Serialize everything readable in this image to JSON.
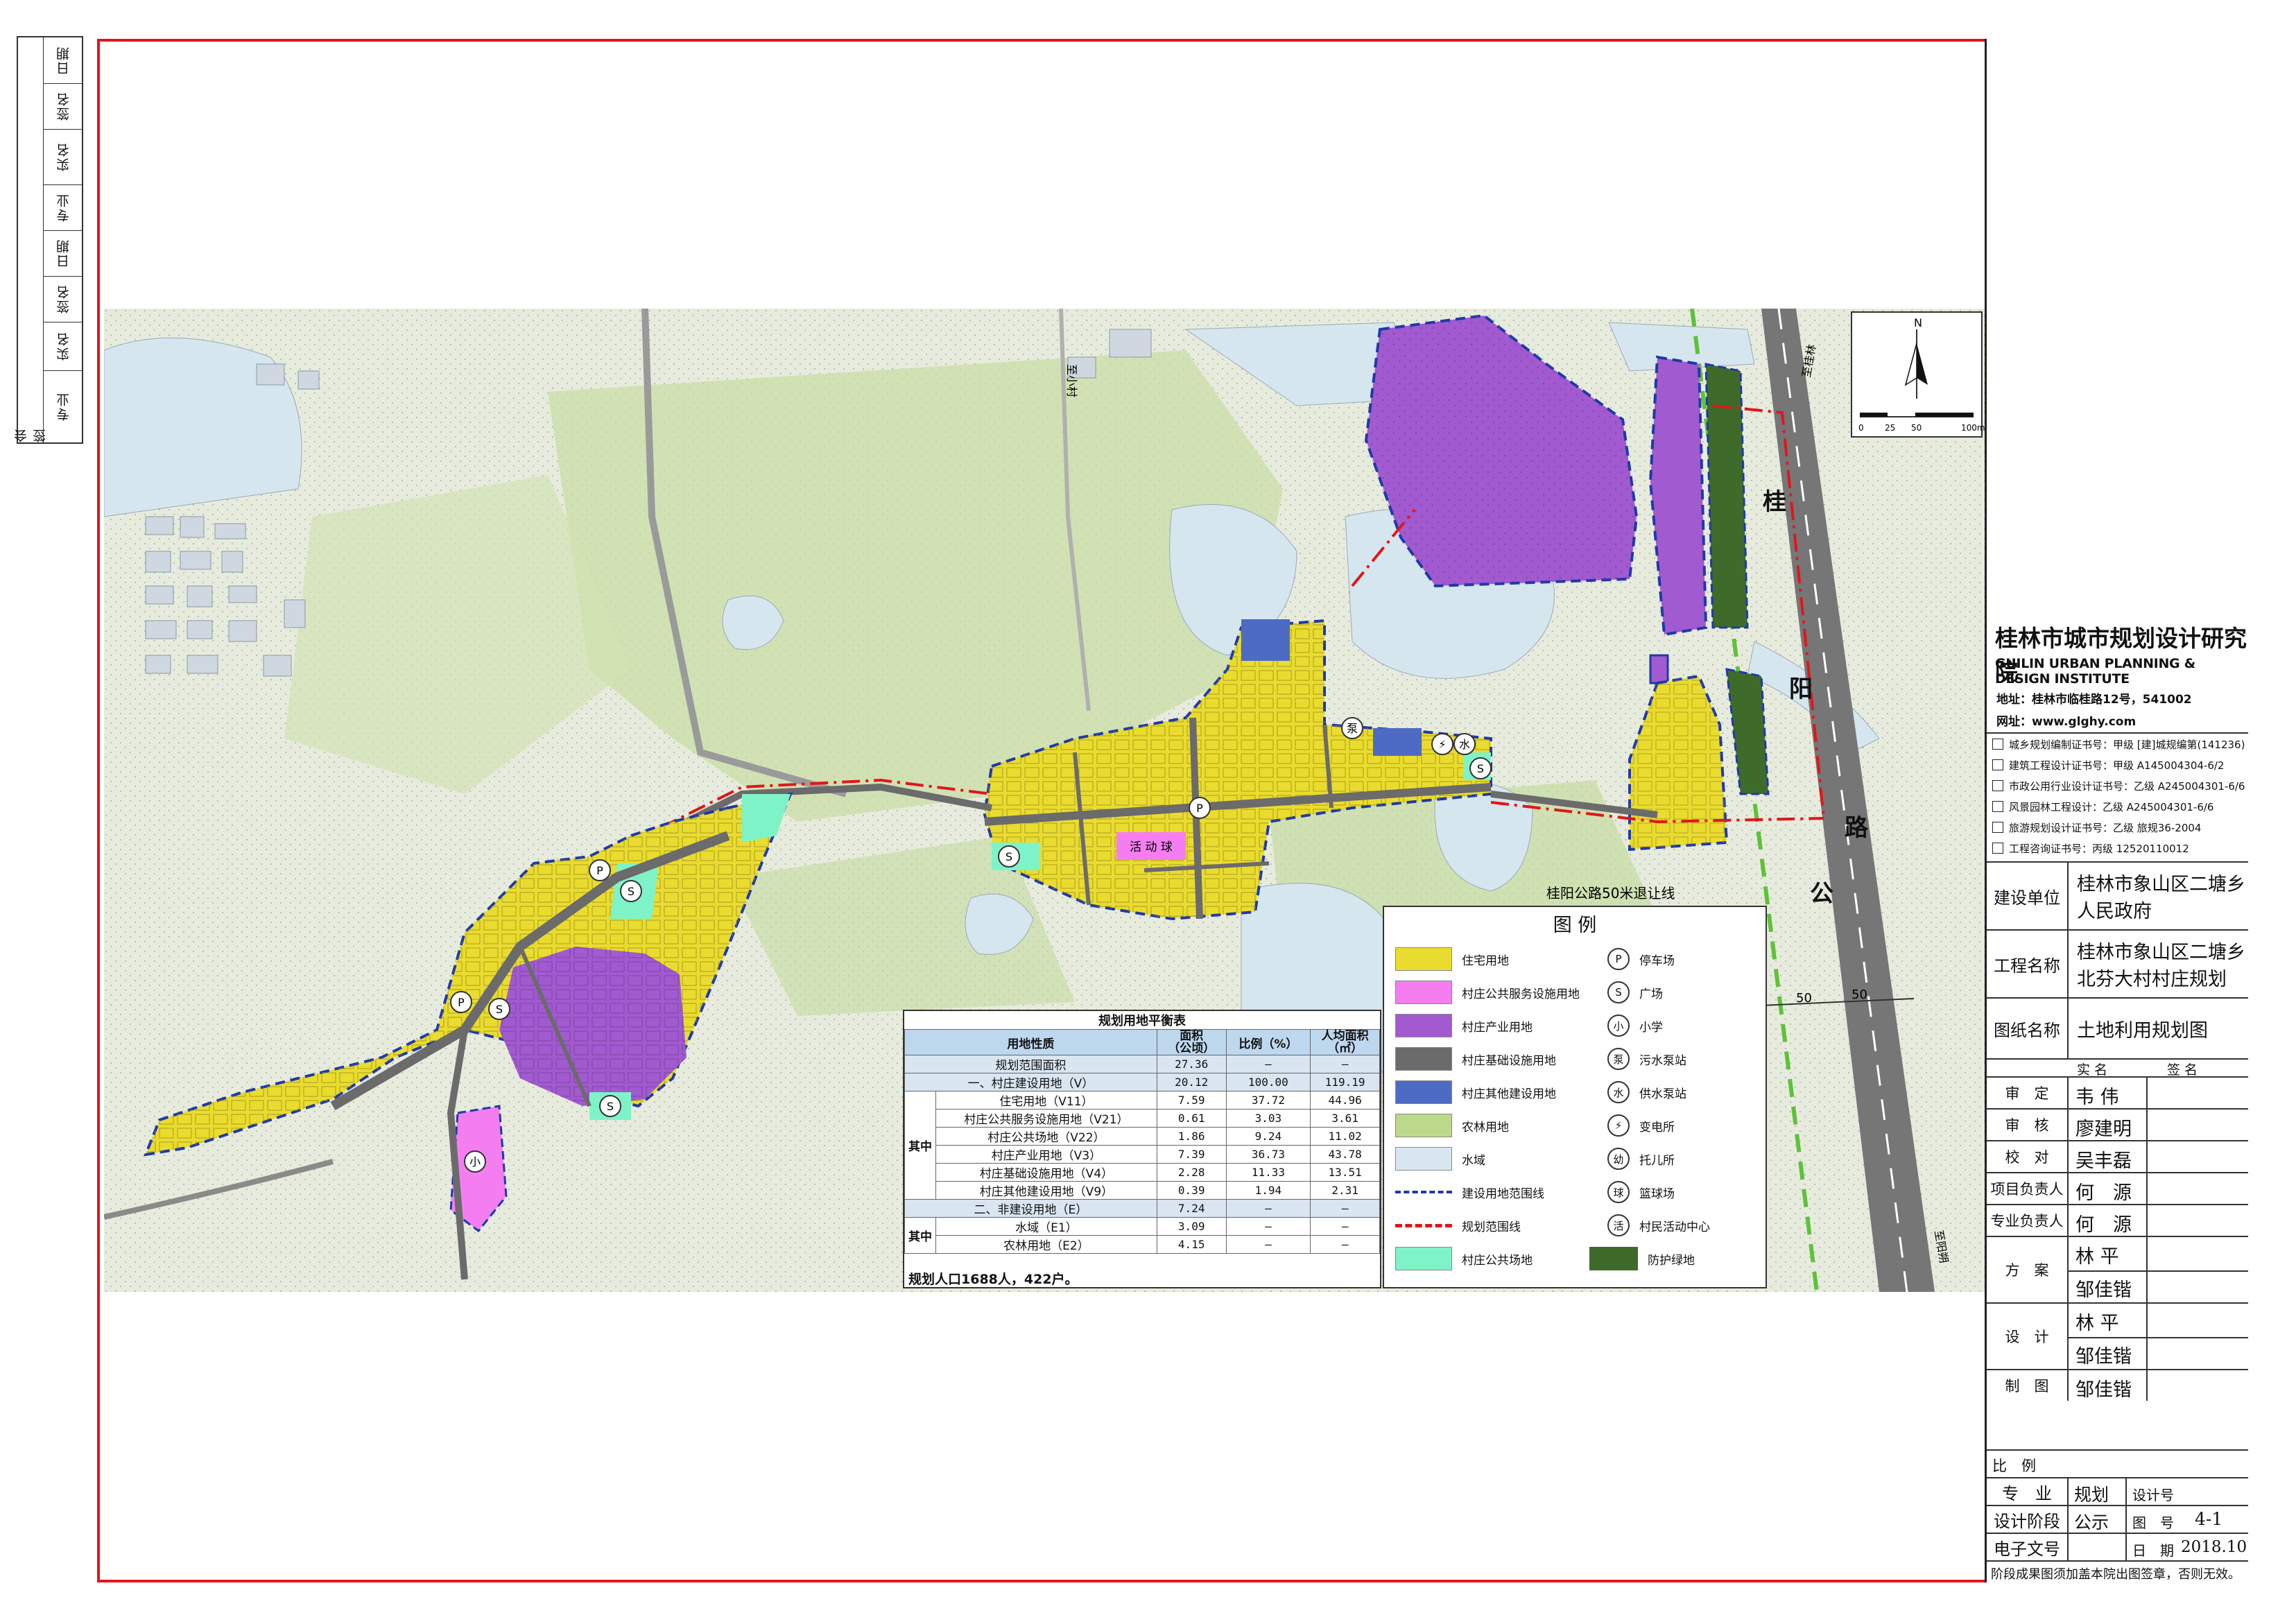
{
  "countersign": {
    "label": "会签",
    "rows": [
      "专业",
      "实名",
      "签名",
      "日期",
      "专业",
      "实名",
      "签名",
      "日期"
    ]
  },
  "institute": {
    "name_cn": "桂林市城市规划设计研究院",
    "name_en": "GUILIN URBAN PLANNING & DESIGN INSTITUTE",
    "address": "地址：桂林市临桂路12号，541002",
    "website": "网址：www.glghy.com",
    "certificates": [
      "城乡规划编制证书号：甲级 [建]城规编第(141236)",
      "建筑工程设计证书号：甲级 A145004304-6/2",
      "市政公用行业设计证书号：乙级 A245004301-6/6",
      "风景园林工程设计：乙级 A245004301-6/6",
      "旅游规划设计证书号：乙级 旅规36-2004",
      "工程咨询证书号：丙级 12520110012"
    ]
  },
  "project": {
    "client_label": "建设单位",
    "client_line1": "桂林市象山区二塘乡",
    "client_line2": "人民政府",
    "project_label": "工程名称",
    "project_line1": "桂林市象山区二塘乡",
    "project_line2": "北芬大村村庄规划",
    "drawing_label": "图纸名称",
    "drawing_name": "土地利用规划图"
  },
  "signoff": {
    "col_name": "实 名",
    "col_sign": "签 名",
    "rows": [
      {
        "role": "审　定",
        "name": "韦 伟"
      },
      {
        "role": "审　核",
        "name": "廖建明"
      },
      {
        "role": "校　对",
        "name": "吴丰磊"
      },
      {
        "role": "项目负责人",
        "name": "何　源"
      },
      {
        "role": "专业负责人",
        "name": "何　源"
      },
      {
        "role": "方　案",
        "name": "林 平",
        "name2": "邹佳锴"
      },
      {
        "role": "设　计",
        "name": "林 平",
        "name2": "邹佳锴"
      },
      {
        "role": "制　图",
        "name": "邹佳锴"
      }
    ]
  },
  "meta": {
    "scale_label": "比　例",
    "discipline_label": "专　业",
    "discipline": "规划",
    "design_no_label": "设计号",
    "stage_label": "设计阶段",
    "stage": "公示",
    "sheet_label": "图　号",
    "sheet": "4-1",
    "file_label": "电子文号",
    "date_label": "日　期",
    "date": "2018.10",
    "footer": "阶段成果图须加盖本院出图签章，否则无效。"
  },
  "map": {
    "north": "N",
    "scale_ticks": [
      "0",
      "25",
      "50",
      "100m"
    ],
    "road_chars": [
      "桂",
      "阳",
      "公",
      "路"
    ],
    "setback_note": "桂阳公路50米退让线",
    "dim_left": "50",
    "dim_right": "50",
    "place_labels": [
      "至桂林",
      "至阳朔",
      "至小村"
    ],
    "plaza_text": "活 动 球"
  },
  "legend": {
    "title": "图 例",
    "left": [
      {
        "label": "住宅用地",
        "color": "#eadc2e"
      },
      {
        "label": "村庄公共服务设施用地",
        "color": "#f47ef0"
      },
      {
        "label": "村庄产业用地",
        "color": "#a25ad0"
      },
      {
        "label": "村庄基础设施用地",
        "color": "#6b6b6b"
      },
      {
        "label": "村庄其他建设用地",
        "color": "#4e6bc4"
      },
      {
        "label": "农林用地",
        "color": "#bcd98a"
      },
      {
        "label": "水域",
        "color": "#d8e7ef"
      },
      {
        "label": "建设用地范围线",
        "color": "#1f3aa8"
      },
      {
        "label": "规划范围线",
        "color": "#e0161b"
      },
      {
        "label": "村庄公共场地",
        "color": "#7ff3c8"
      }
    ],
    "right": [
      {
        "label": "停车场",
        "glyph": "P"
      },
      {
        "label": "广场",
        "glyph": "S"
      },
      {
        "label": "小学",
        "glyph": "小"
      },
      {
        "label": "污水泵站",
        "glyph": "泵"
      },
      {
        "label": "供水泵站",
        "glyph": "水"
      },
      {
        "label": "变电所",
        "glyph": "⚡"
      },
      {
        "label": "托儿所",
        "glyph": "幼"
      },
      {
        "label": "篮球场",
        "glyph": "球"
      },
      {
        "label": "村民活动中心",
        "glyph": "活"
      },
      {
        "label": "防护绿地",
        "color": "#3e6b2a"
      }
    ]
  },
  "balance": {
    "title": "规划用地平衡表",
    "headers": [
      "用地性质",
      "面积\n（公顷）",
      "比例（%）",
      "人均面积\n（㎡）"
    ],
    "total": {
      "name": "规划范围面积",
      "area": "27.36",
      "ratio": "–",
      "per": "–"
    },
    "section1": {
      "name": "一、村庄建设用地（V）",
      "area": "20.12",
      "ratio": "100.00",
      "per": "119.19"
    },
    "group_label": "其中",
    "rows1": [
      {
        "name": "住宅用地（V11）",
        "area": "7.59",
        "ratio": "37.72",
        "per": "44.96"
      },
      {
        "name": "村庄公共服务设施用地（V21）",
        "area": "0.61",
        "ratio": "3.03",
        "per": "3.61"
      },
      {
        "name": "村庄公共场地（V22）",
        "area": "1.86",
        "ratio": "9.24",
        "per": "11.02"
      },
      {
        "name": "村庄产业用地（V3）",
        "area": "7.39",
        "ratio": "36.73",
        "per": "43.78"
      },
      {
        "name": "村庄基础设施用地（V4）",
        "area": "2.28",
        "ratio": "11.33",
        "per": "13.51"
      },
      {
        "name": "村庄其他建设用地（V9）",
        "area": "0.39",
        "ratio": "1.94",
        "per": "2.31"
      }
    ],
    "section2": {
      "name": "二、非建设用地（E）",
      "area": "7.24",
      "ratio": "–",
      "per": "–"
    },
    "rows2": [
      {
        "name": "水域（E1）",
        "area": "3.09",
        "ratio": "–",
        "per": "–"
      },
      {
        "name": "农林用地（E2）",
        "area": "4.15",
        "ratio": "–",
        "per": "–"
      }
    ],
    "population": "规划人口1688人，422户。"
  }
}
